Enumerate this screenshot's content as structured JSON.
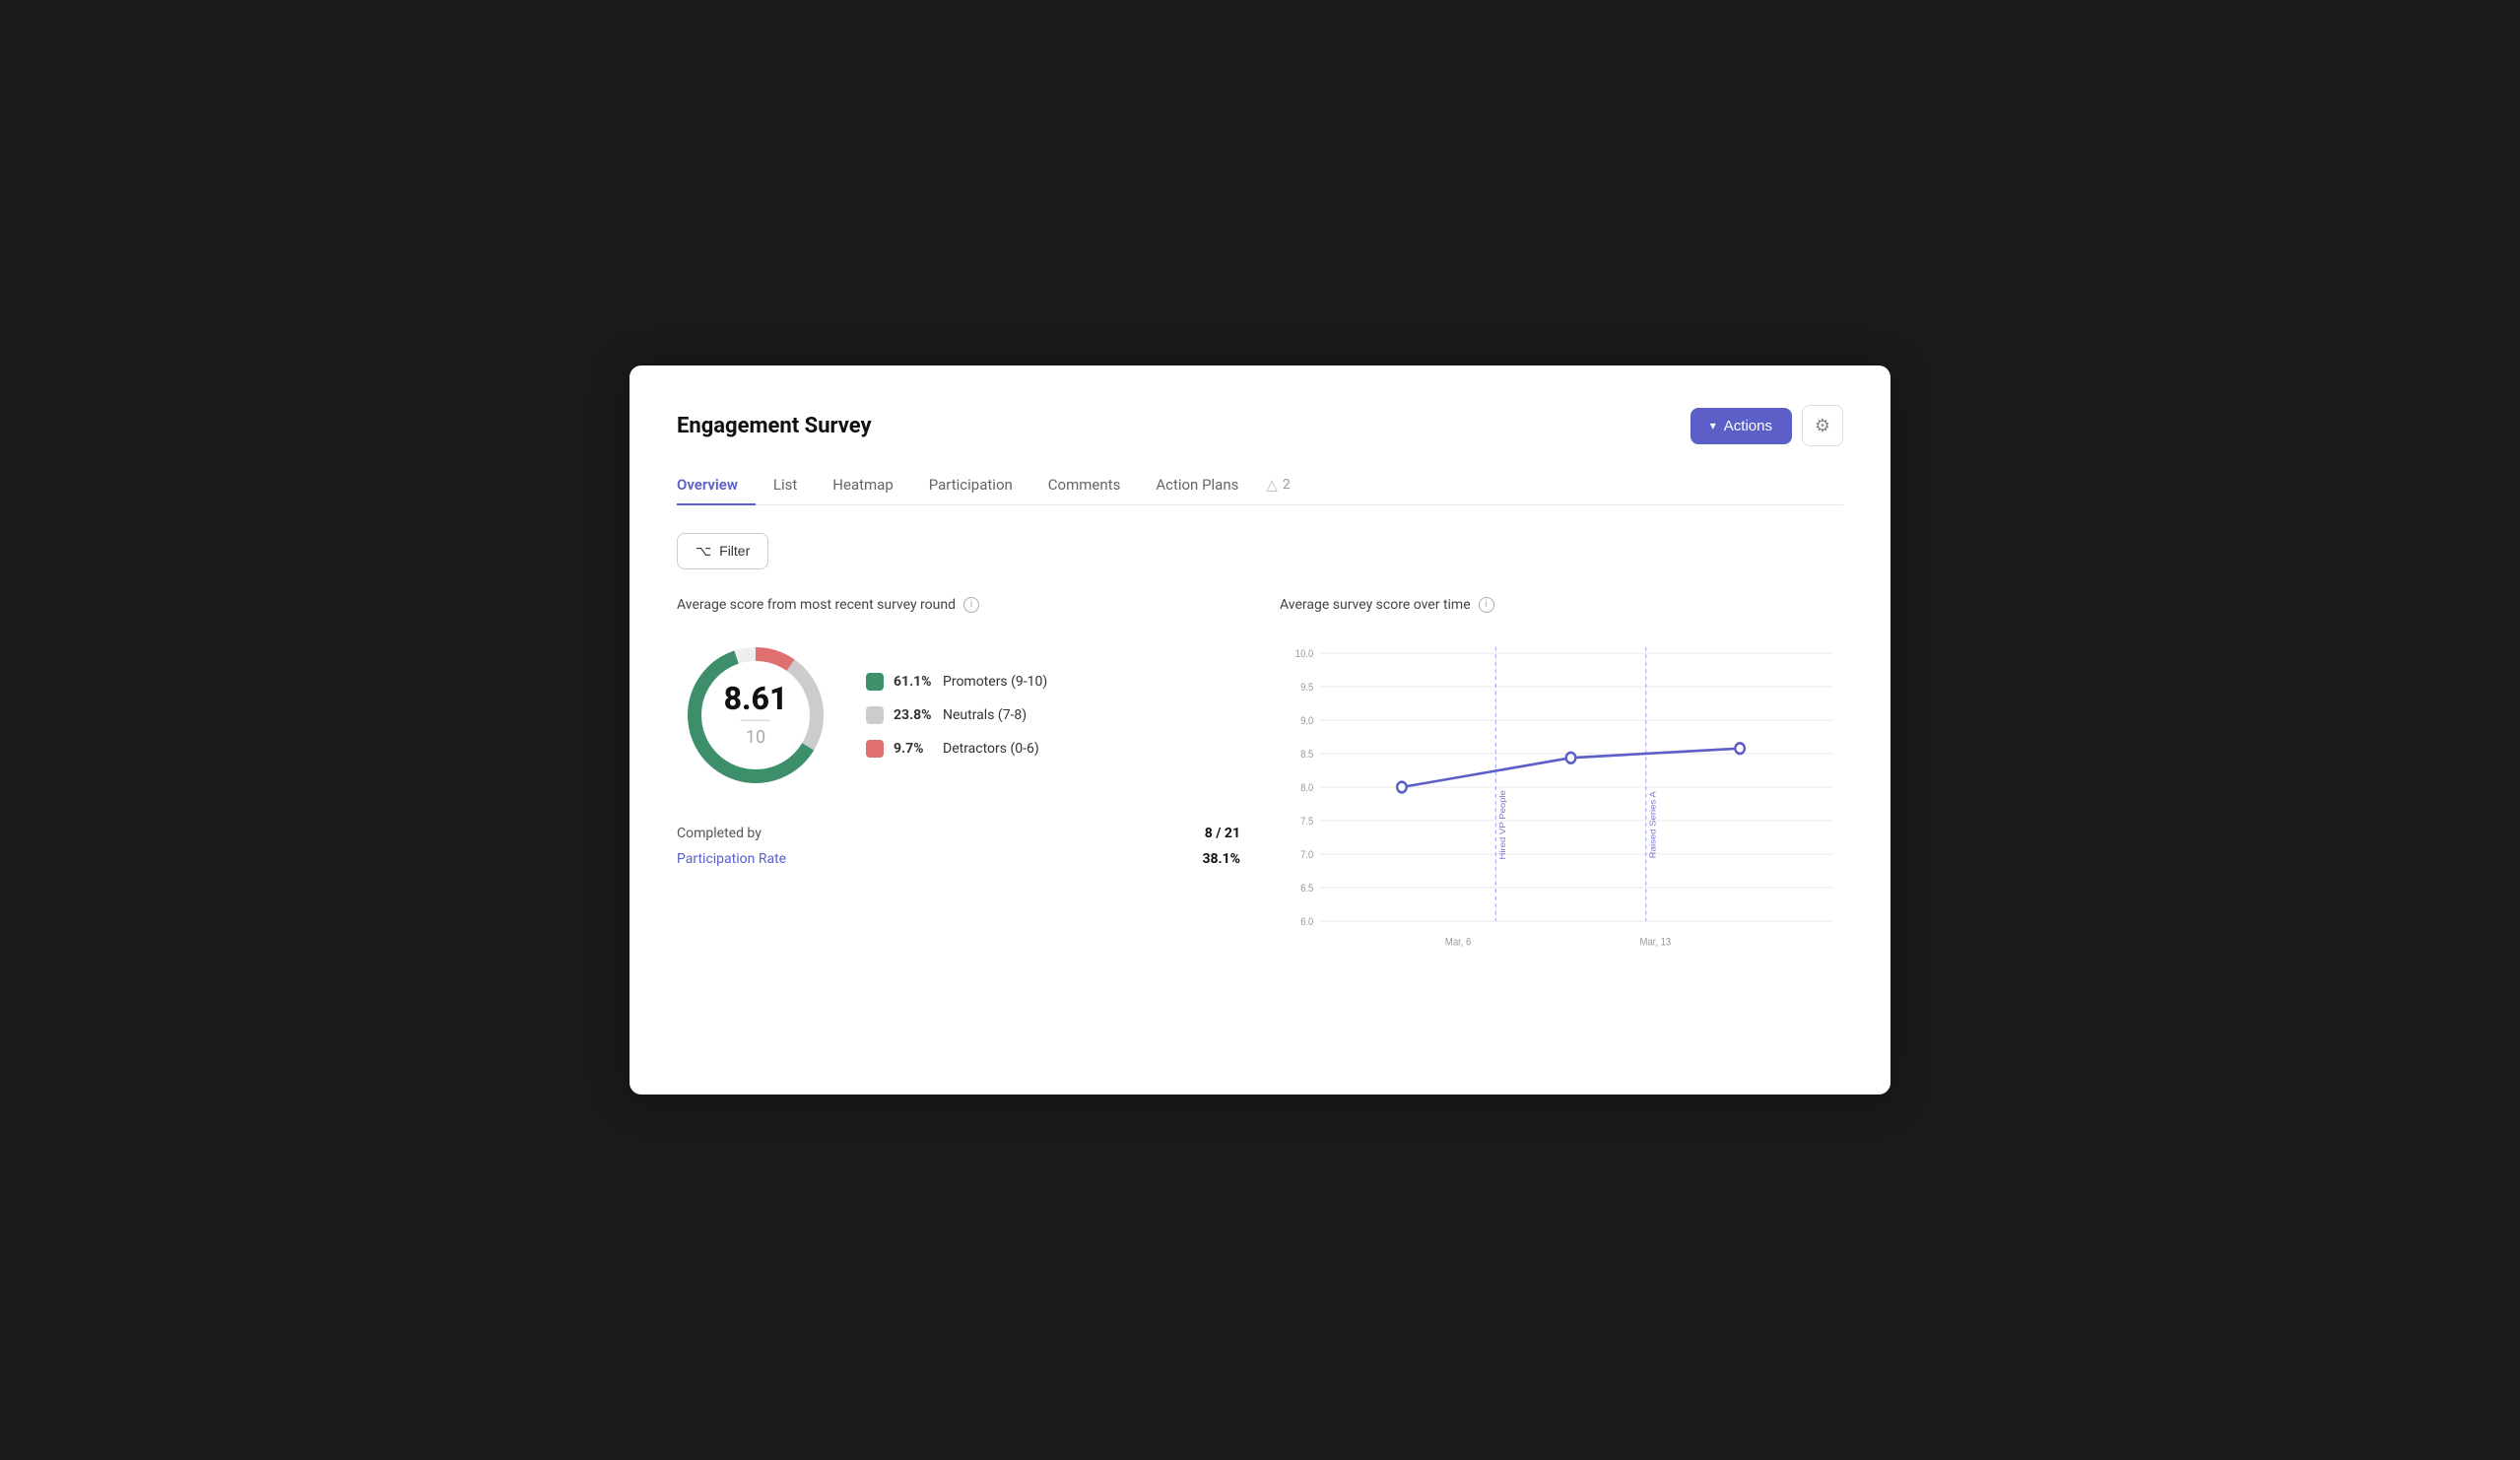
{
  "page": {
    "title": "Engagement Survey",
    "actions_button": "Actions",
    "settings_icon": "gear"
  },
  "tabs": [
    {
      "label": "Overview",
      "active": true
    },
    {
      "label": "List",
      "active": false
    },
    {
      "label": "Heatmap",
      "active": false
    },
    {
      "label": "Participation",
      "active": false
    },
    {
      "label": "Comments",
      "active": false
    },
    {
      "label": "Action Plans",
      "active": false
    }
  ],
  "warning_count": "2",
  "filter_label": "Filter",
  "left_panel": {
    "section_title": "Average score from most recent survey round",
    "score": "8.61",
    "score_max": "10",
    "legend": [
      {
        "color": "#3d8f6c",
        "pct": "61.1%",
        "label": "Promoters (9-10)"
      },
      {
        "color": "#cccccc",
        "pct": "23.8%",
        "label": "Neutrals (7-8)"
      },
      {
        "color": "#e07070",
        "pct": "9.7%",
        "label": "Detractors (0-6)"
      }
    ],
    "completed_by_label": "Completed by",
    "completed_by_value": "8 / 21",
    "participation_rate_label": "Participation Rate",
    "participation_rate_value": "38.1%"
  },
  "right_panel": {
    "section_title": "Average survey score over time",
    "y_axis": [
      "10.0",
      "9.5",
      "9.0",
      "8.5",
      "8.0",
      "7.5",
      "7.0",
      "6.5",
      "6.0"
    ],
    "x_axis": [
      "Mar, 6",
      "Mar, 13"
    ],
    "annotations": [
      {
        "label": "Hired VP People",
        "x_pos": 0.38
      },
      {
        "label": "Raised Series A",
        "x_pos": 0.72
      }
    ],
    "data_points": [
      {
        "x": 0.22,
        "y": 8.0
      },
      {
        "x": 0.52,
        "y": 8.45
      },
      {
        "x": 0.82,
        "y": 8.6
      }
    ]
  }
}
